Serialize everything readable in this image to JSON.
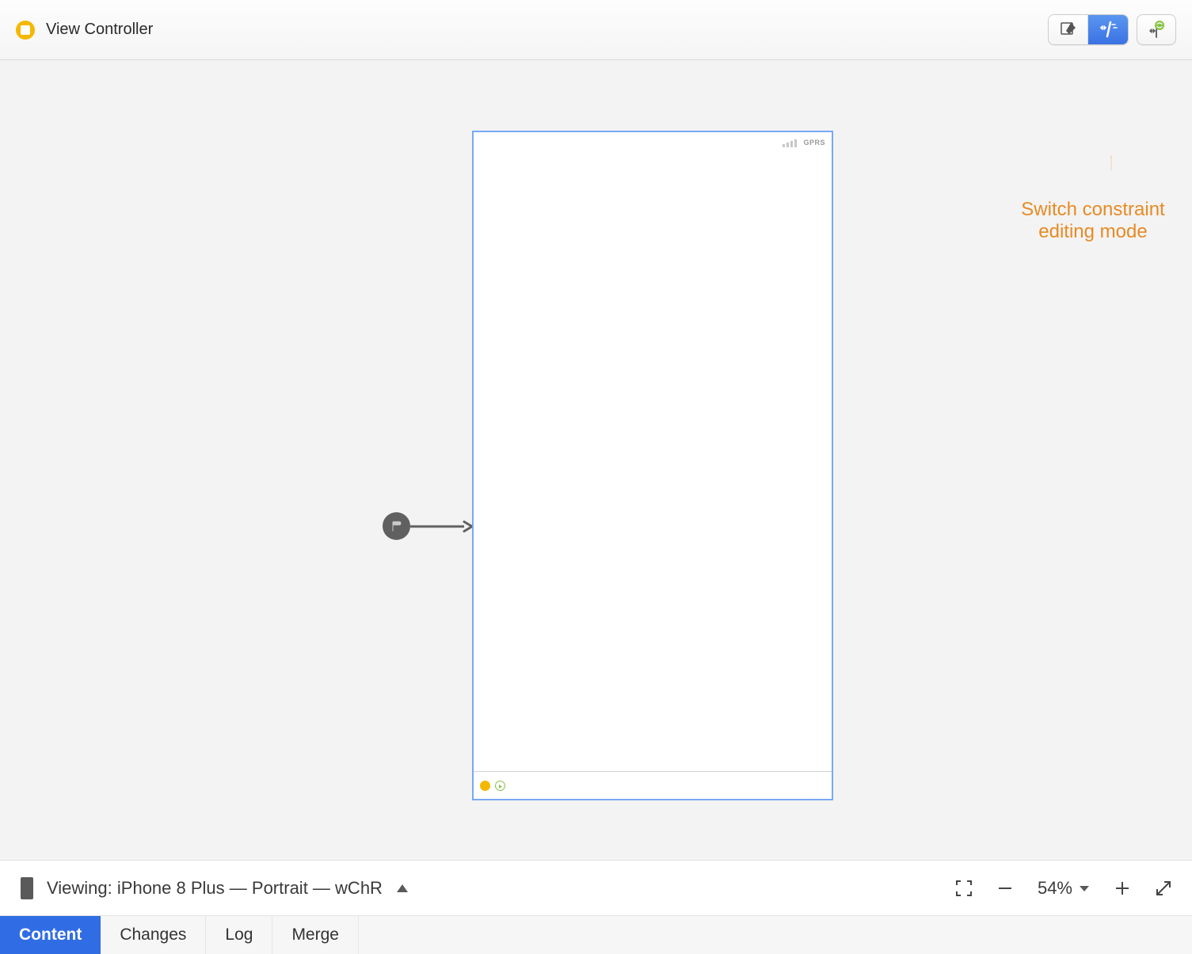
{
  "header": {
    "title": "View Controller"
  },
  "toolbar": {
    "pencil_tooltip": "Edit",
    "constraint_tooltip": "Constraints",
    "toggle_tooltip": "Toggle"
  },
  "status_bar": {
    "signal": "signal",
    "network_label": "GPRS"
  },
  "annotation": {
    "line1": "Switch constraint",
    "line2": "editing mode"
  },
  "bottom_bar": {
    "viewing_prefix": "Viewing:",
    "device": "iPhone 8 Plus",
    "orientation": "Portrait",
    "size_class": "wChR",
    "zoom_value": "54%"
  },
  "tabs": [
    {
      "label": "Content",
      "active": true
    },
    {
      "label": "Changes",
      "active": false
    },
    {
      "label": "Log",
      "active": false
    },
    {
      "label": "Merge",
      "active": false
    }
  ]
}
